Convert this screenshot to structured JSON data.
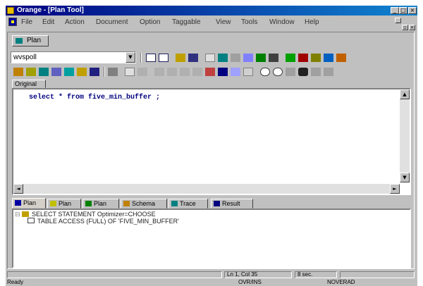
{
  "window": {
    "title": "Orange - [Plan Tool]",
    "min": "_",
    "max": "□",
    "close": "×"
  },
  "menu": [
    "File",
    "Edit",
    "Action",
    "Document",
    "Option",
    "Taggable",
    "View",
    "Tools",
    "Window",
    "Help"
  ],
  "mdi": {
    "min": "_",
    "restore": "▫",
    "close": "×"
  },
  "doc_tab": "Plan",
  "schema_combo": {
    "value": "wvspoll",
    "arrow": "▼"
  },
  "sub_tab": "Original",
  "editor": {
    "sql": "select * from five_min_buffer ;"
  },
  "scroll": {
    "up": "▲",
    "down": "▼",
    "left": "◄",
    "right": "►"
  },
  "result_tabs": [
    {
      "label": "Plan",
      "color": "#0000a0"
    },
    {
      "label": "Plan",
      "color": "#c0c000"
    },
    {
      "label": "Plan",
      "color": "#008000"
    },
    {
      "label": "Schema",
      "color": "#c08000"
    },
    {
      "label": "Trace",
      "color": "#008080"
    },
    {
      "label": "Result",
      "color": "#000080"
    }
  ],
  "plan_tree": [
    {
      "text": "SELECT STATEMENT Optimizer=CHOOSE"
    },
    {
      "text": "TABLE ACCESS (FULL) OF 'FIVE_MIN_BUFFER'"
    }
  ],
  "status": {
    "position": "Ln 1, Col 35",
    "time": "8 sec.",
    "ready": "Ready",
    "mode": "OVR/INS",
    "rad": "NOVERAD"
  }
}
